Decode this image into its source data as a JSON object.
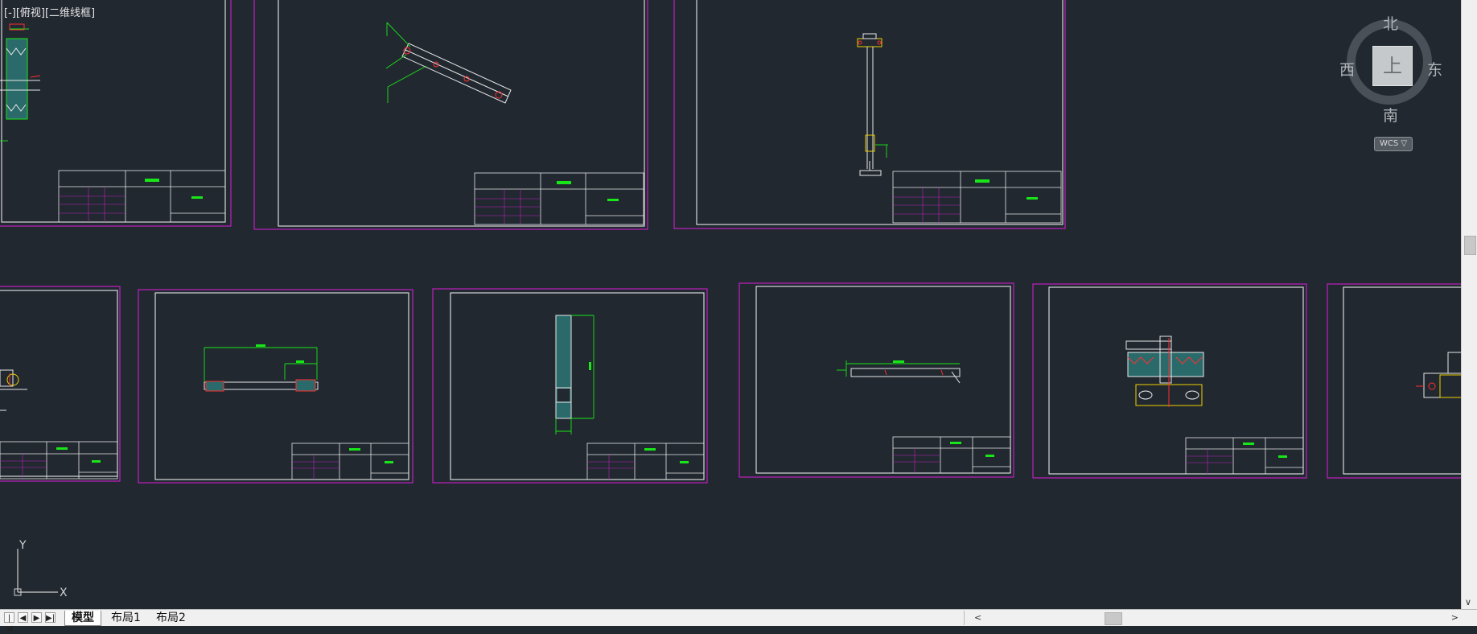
{
  "viewport": {
    "view_label": "[-][俯视][二维线框]"
  },
  "viewcube": {
    "north": "北",
    "south": "南",
    "east": "东",
    "west": "西",
    "face": "上",
    "wcs_label": "WCS ▽"
  },
  "ucs": {
    "x_label": "X",
    "y_label": "Y"
  },
  "tabs": {
    "nav_first": "|◀",
    "nav_prev": "◀",
    "nav_next": "▶",
    "nav_last": "▶|",
    "model": "模型",
    "layout1": "布局1",
    "layout2": "布局2"
  },
  "scroll": {
    "left_arrow": "<",
    "right_arrow": ">",
    "down_arrow": "∨"
  },
  "colors": {
    "background": "#212830",
    "sheet_border": "#c020c0",
    "line_white": "#e8e8e8",
    "annotation_green": "#19e619",
    "highlight_red": "#ff3030",
    "highlight_yellow": "#f0d000"
  }
}
